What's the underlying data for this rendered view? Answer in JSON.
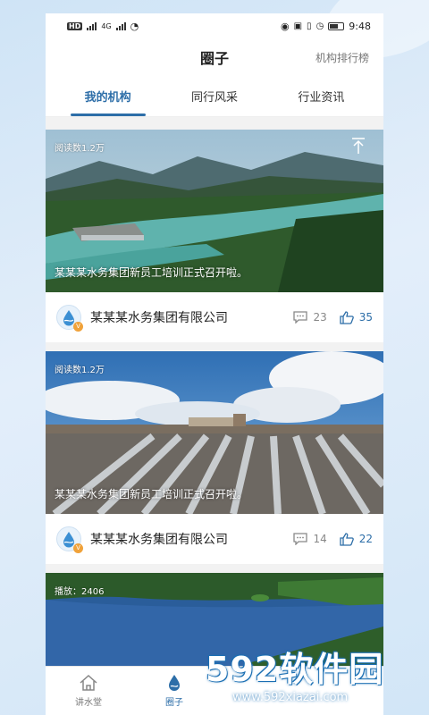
{
  "status_bar": {
    "left": [
      "HD",
      "4G"
    ],
    "time": "9:48"
  },
  "header": {
    "title": "圈子",
    "rank_link": "机构排行榜"
  },
  "tabs": [
    {
      "label": "我的机构",
      "active": true
    },
    {
      "label": "同行风采",
      "active": false
    },
    {
      "label": "行业资讯",
      "active": false
    }
  ],
  "posts": [
    {
      "reads": "阅读数1.2万",
      "caption": "某某某水务集团新员工培训正式召开啦。",
      "org": "某某某水务集团有限公司",
      "comments": "23",
      "likes": "35",
      "scene": "river-valley"
    },
    {
      "reads": "阅读数1.2万",
      "caption": "某某某水务集团新员工培训正式召开啦。",
      "org": "某某某水务集团有限公司",
      "comments": "14",
      "likes": "22",
      "scene": "weir"
    },
    {
      "plays": "播放：2406",
      "scene": "lake"
    }
  ],
  "tabbar": [
    {
      "label": "讲水堂",
      "icon": "house-icon",
      "active": false
    },
    {
      "label": "圈子",
      "icon": "water-drop-icon",
      "active": true
    }
  ],
  "watermark": {
    "logo": "592软件园",
    "url": "www.592xiazai.com"
  },
  "colors": {
    "accent": "#2d6ea8",
    "background": "#d6e8f8"
  }
}
